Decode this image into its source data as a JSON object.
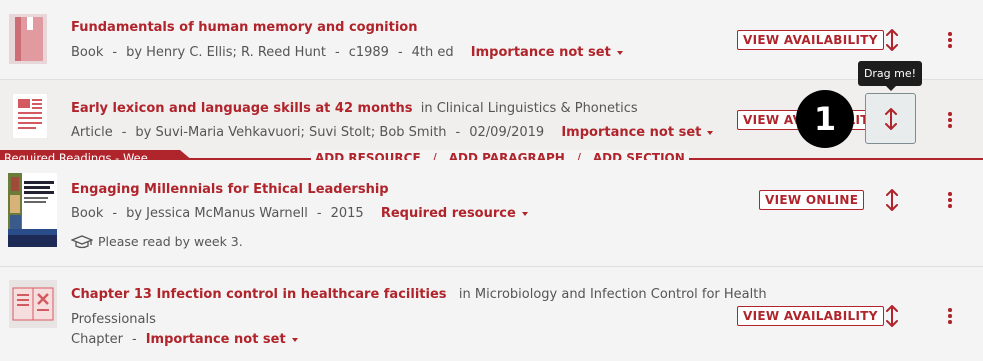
{
  "colors": {
    "accent": "#b0242b",
    "section_bar": "#b0242b",
    "tooltip_bg": "#1d1d1d"
  },
  "items": [
    {
      "title": "Fundamentals of human memory and cognition",
      "type": "Book",
      "authors": "by Henry C. Ellis; R. Reed Hunt",
      "date": "c1989",
      "edition": "4th ed",
      "importance": "Importance not set",
      "button": "VIEW AVAILABILITY",
      "thumb_icon": "book-icon"
    },
    {
      "title": "Early lexicon and language skills at 42 months",
      "in_text": "in Clinical Linguistics & Phonetics",
      "type": "Article",
      "authors": "by Suvi-Maria Vehkavuori; Suvi Stolt; Bob Smith",
      "date": "02/09/2019",
      "importance": "Importance not set",
      "button": "VIEW AVAILABILITY",
      "thumb_icon": "article-icon"
    },
    {
      "title": "Engaging Millennials for Ethical Leadership",
      "type": "Book",
      "authors": "by Jessica McManus Warnell",
      "date": "2015",
      "importance": "Required resource",
      "button": "VIEW ONLINE",
      "note": "Please read by week 3.",
      "thumb_icon": "book-cover-image"
    },
    {
      "title": "Chapter 13 Infection control in healthcare facilities",
      "in_text": "in Microbiology and Infection Control for Health",
      "in_text_cont": "Professionals",
      "type": "Chapter",
      "importance": "Importance not set",
      "button": "VIEW AVAILABILITY",
      "thumb_icon": "chapter-icon"
    }
  ],
  "section": {
    "label": "Required Readings - Wee...",
    "add_resource": "ADD RESOURCE",
    "add_paragraph": "ADD PARAGRAPH",
    "add_section": "ADD SECTION",
    "slash": "/"
  },
  "tooltip": "Drag me!",
  "step_badge": "1",
  "sep": "-"
}
